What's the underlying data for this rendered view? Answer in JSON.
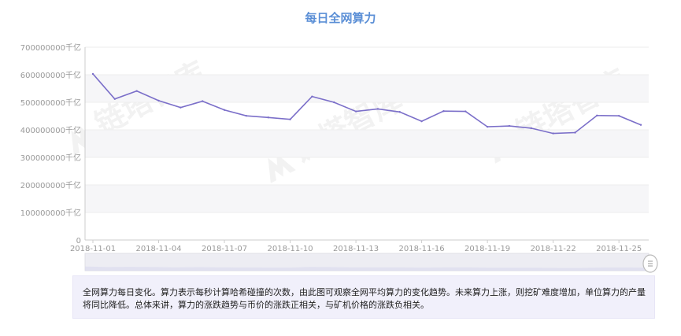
{
  "title": "每日全网算力",
  "chart_data": {
    "type": "line",
    "title": "每日全网算力",
    "y_unit_suffix": "千亿",
    "ylim": [
      0,
      700000000
    ],
    "y_ticks": [
      0,
      100000000,
      200000000,
      300000000,
      400000000,
      500000000,
      600000000,
      700000000
    ],
    "y_tick_labels": [
      "0",
      "100000000千亿",
      "200000000千亿",
      "300000000千亿",
      "400000000千亿",
      "500000000千亿",
      "600000000千亿",
      "700000000千亿"
    ],
    "x": [
      "2018-11-01",
      "2018-11-02",
      "2018-11-03",
      "2018-11-04",
      "2018-11-05",
      "2018-11-06",
      "2018-11-07",
      "2018-11-08",
      "2018-11-09",
      "2018-11-10",
      "2018-11-11",
      "2018-11-12",
      "2018-11-13",
      "2018-11-14",
      "2018-11-15",
      "2018-11-16",
      "2018-11-17",
      "2018-11-18",
      "2018-11-19",
      "2018-11-20",
      "2018-11-21",
      "2018-11-22",
      "2018-11-23",
      "2018-11-24",
      "2018-11-25",
      "2018-11-26"
    ],
    "x_tick_labels": [
      "2018-11-01",
      "2018-11-04",
      "2018-11-07",
      "2018-11-10",
      "2018-11-13",
      "2018-11-16",
      "2018-11-19",
      "2018-11-22",
      "2018-11-25"
    ],
    "series": [
      {
        "values": [
          603000000,
          512000000,
          541000000,
          506000000,
          481000000,
          504000000,
          472000000,
          451000000,
          445000000,
          438000000,
          521000000,
          500000000,
          467000000,
          476000000,
          465000000,
          431000000,
          468000000,
          467000000,
          411000000,
          414000000,
          406000000,
          387000000,
          390000000,
          452000000,
          451000000,
          418000000
        ]
      }
    ],
    "line_color": "#7b6fc9",
    "grid": true
  },
  "description": "全网算力每日变化。算力表示每秒计算哈希碰撞的次数，由此图可观察全网平均算力的变化趋势。未来算力上涨，则挖矿难度增加，单位算力的产量将同比降低。总体来讲，算力的涨跌趋势与币价的涨跌正相关，与矿机价格的涨跌负相关。",
  "watermark": "链塔智库"
}
